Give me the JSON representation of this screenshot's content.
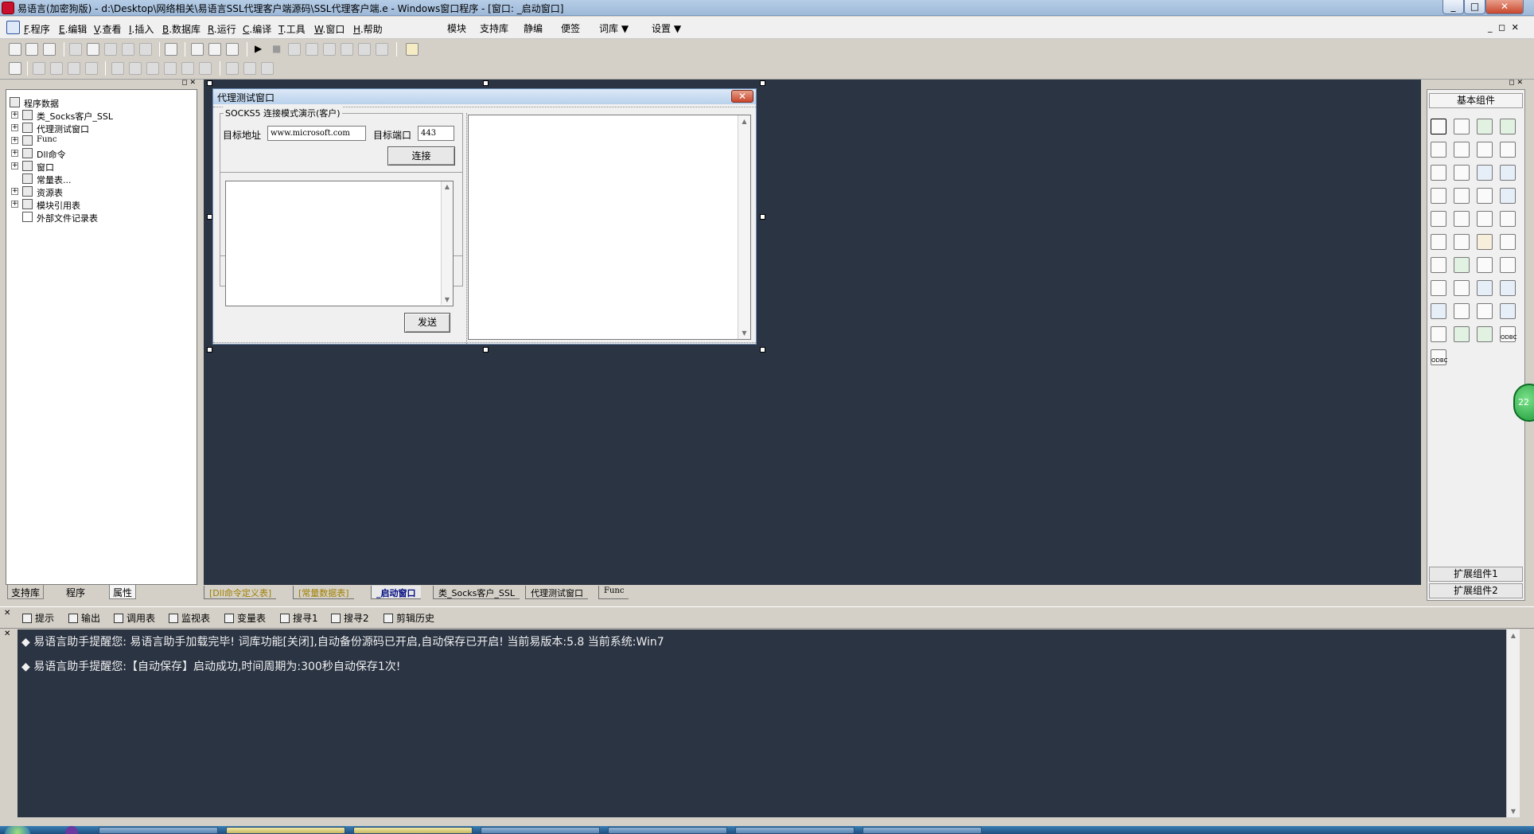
{
  "window": {
    "title": "易语言(加密狗版) - d:\\Desktop\\网络相关\\易语言SSL代理客户端源码\\SSL代理客户端.e - Windows窗口程序 - [窗口: _启动窗口]",
    "minimize": "_",
    "maximize": "□",
    "close": "✕",
    "mdi_controls": "_ ◻ ✕"
  },
  "menubar": {
    "left_items": [
      {
        "key": "F",
        "label": ".程序"
      },
      {
        "key": "E",
        "label": ".编辑"
      },
      {
        "key": "V",
        "label": ".查看"
      },
      {
        "key": "I",
        "label": ".插入"
      },
      {
        "key": "B",
        "label": ".数据库"
      },
      {
        "key": "R",
        "label": ".运行"
      },
      {
        "key": "C",
        "label": ".编译"
      },
      {
        "key": "T",
        "label": ".工具"
      },
      {
        "key": "W",
        "label": ".窗口"
      },
      {
        "key": "H",
        "label": ".帮助"
      }
    ],
    "right_items": [
      "模块",
      "支持库",
      "静编",
      "便签",
      "词库 ▼",
      "设置 ▼"
    ]
  },
  "left_panel": {
    "root": "程序数据",
    "items": [
      {
        "label": "类_Socks客户_SSL",
        "expander": "+"
      },
      {
        "label": "代理测试窗口",
        "expander": "+"
      },
      {
        "label": "Func",
        "expander": "+"
      },
      {
        "label": "Dll命令",
        "expander": "+"
      },
      {
        "label": "窗口",
        "expander": "+"
      },
      {
        "label": "常量表...",
        "expander": ""
      },
      {
        "label": "资源表",
        "expander": "+"
      },
      {
        "label": "模块引用表",
        "expander": "+"
      },
      {
        "label": "外部文件记录表",
        "expander": ""
      }
    ],
    "tabs": [
      "支持库",
      "程序",
      "属性"
    ],
    "header_controls": "◻ ✕"
  },
  "form": {
    "title": "代理测试窗口",
    "close": "✕",
    "group_title": "SOCKS5 连接模式演示(客户)",
    "target_address_label": "目标地址",
    "target_address_value": "www.microsoft.com",
    "target_port_label": "目标端口",
    "target_port_value": "443",
    "connect_button": "连接",
    "send_button": "发送",
    "scroll_up": "▲",
    "scroll_down": "▼"
  },
  "right_panel": {
    "title": "基本组件",
    "ext1": "扩展组件1",
    "ext2": "扩展组件2",
    "header_controls": "◻ ✕",
    "odbc1": "ODBC",
    "odbc2": "ODBC"
  },
  "editor_tabs": [
    "[Dll命令定义表]",
    "[常量数据表]",
    "_启动窗口",
    "类_Socks客户_SSL",
    "代理测试窗口",
    "Func"
  ],
  "output_tabs": [
    "提示",
    "输出",
    "调用表",
    "监视表",
    "变量表",
    "搜寻1",
    "搜寻2",
    "剪辑历史"
  ],
  "output_messages": [
    "易语言助手提醒您:  易语言助手加载完毕! 词库功能[关闭],自动备份源码已开启,自动保存已开启! 当前易版本:5.8  当前系统:Win7",
    "易语言助手提醒您:【自动保存】启动成功,时间周期为:300秒自动保存1次!"
  ],
  "bullet": "◆",
  "green_badge": "22",
  "colors": {
    "workspace_bg": "#2b3443",
    "title_gradient": "#b6cde6",
    "accent_close": "#c8462c"
  }
}
